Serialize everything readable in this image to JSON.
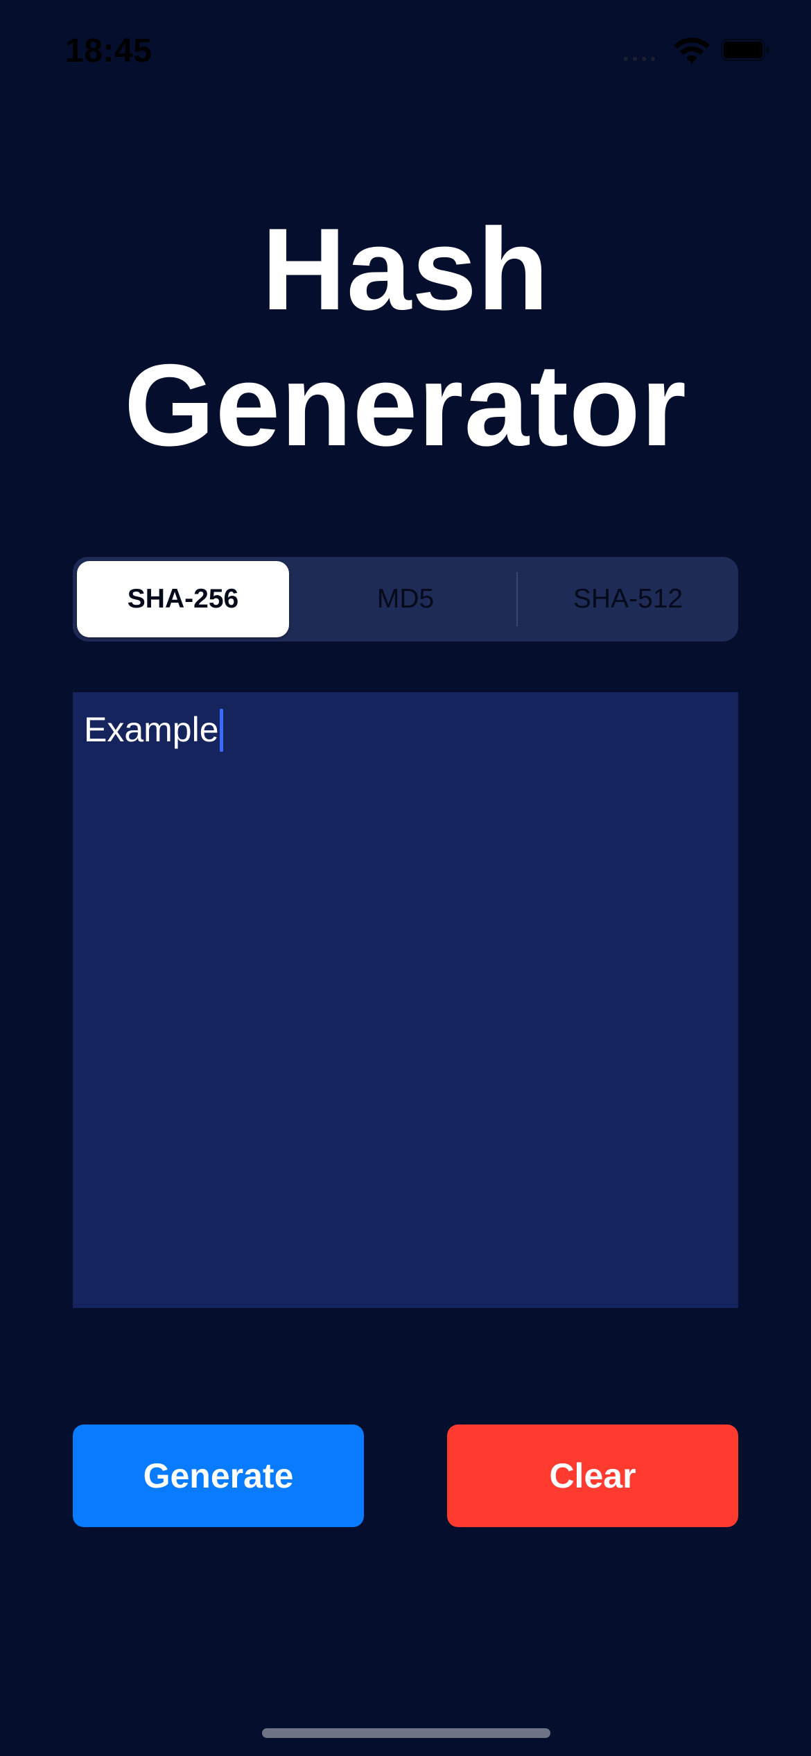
{
  "status_bar": {
    "time": "18:45"
  },
  "header": {
    "title_line1": "Hash",
    "title_line2": "Generator"
  },
  "algorithm_picker": {
    "options": [
      "SHA-256",
      "MD5",
      "SHA-512"
    ],
    "selected": "SHA-256"
  },
  "input": {
    "value": "Example"
  },
  "actions": {
    "generate_label": "Generate",
    "clear_label": "Clear"
  },
  "colors": {
    "background": "#050e2c",
    "segmented_bg": "#1f2b57",
    "text_area_bg": "#16245e",
    "caret": "#3d6bff",
    "generate": "#087bff",
    "clear": "#ff3b30"
  },
  "icons": {
    "wifi": "wifi-icon",
    "battery": "battery-icon"
  }
}
